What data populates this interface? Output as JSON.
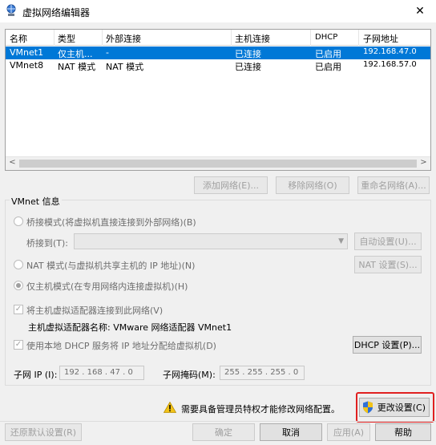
{
  "window": {
    "title": "虚拟网络编辑器",
    "close_glyph": "✕",
    "icon": "network-globe-icon"
  },
  "table": {
    "columns": [
      "名称",
      "类型",
      "外部连接",
      "主机连接",
      "DHCP",
      "子网地址"
    ],
    "rows": [
      {
        "name": "VMnet1",
        "type": "仅主机...",
        "external": "-",
        "host": "已连接",
        "dhcp": "已启用",
        "subnet": "192.168.47.0",
        "selected": true
      },
      {
        "name": "VMnet8",
        "type": "NAT 模式",
        "external": "NAT 模式",
        "host": "已连接",
        "dhcp": "已启用",
        "subnet": "192.168.57.0",
        "selected": false
      }
    ],
    "scroll_left": "<",
    "scroll_right": ">"
  },
  "table_buttons": {
    "add_network": "添加网络(E)...",
    "remove_network": "移除网络(O)",
    "rename_network": "重命名网络(A)..."
  },
  "vmnet_info": {
    "title": "VMnet 信息",
    "bridge_mode": "桥接模式(将虚拟机直接连接到外部网络)(B)",
    "bridge_to": "桥接到(T):",
    "auto_settings": "自动设置(U)...",
    "nat_mode": "NAT 模式(与虚拟机共享主机的 IP 地址)(N)",
    "nat_settings": "NAT 设置(S)...",
    "host_only_mode": "仅主机模式(在专用网络内连接虚拟机)(H)",
    "connect_adapter": "将主机虚拟适配器连接到此网络(V)",
    "adapter_name_label": "主机虚拟适配器名称: VMware 网络适配器 VMnet1",
    "use_dhcp": "使用本地 DHCP 服务将 IP 地址分配给虚拟机(D)",
    "dhcp_settings": "DHCP 设置(P)...",
    "subnet_ip_label": "子网 IP (I):",
    "subnet_ip_value": "192 . 168 . 47 . 0",
    "subnet_mask_label": "子网掩码(M):",
    "subnet_mask_value": "255 . 255 . 255 . 0",
    "selected_mode": "host_only",
    "connect_adapter_checked": true,
    "use_dhcp_checked": true
  },
  "notice": {
    "text": "需要具备管理员特权才能修改网络配置。",
    "change_settings": "更改设置(C)",
    "warn_color": "#f2c318",
    "highlight_color": "#e02020"
  },
  "footer": {
    "restore_defaults": "还原默认设置(R)",
    "ok": "确定",
    "cancel": "取消",
    "apply": "应用(A)",
    "help": "帮助"
  }
}
